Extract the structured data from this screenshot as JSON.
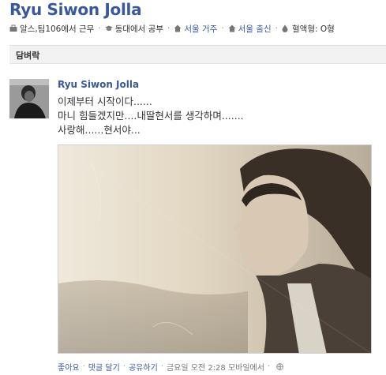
{
  "profile": {
    "name": "Ryu Siwon Jolla"
  },
  "info": {
    "work": "알스,팀106에서 근무",
    "school": "동대에서 공부",
    "lives": "서울 거주",
    "from": "서울 출신",
    "blood": "혈액형: O형"
  },
  "tab": {
    "label": "담벼락"
  },
  "post": {
    "author": "Ryu Siwon Jolla",
    "lines": [
      "이제부터 시작이다......",
      "마니 힘들겠지만....내딸현서를 생각하며.......",
      "사랑해......현서야..."
    ]
  },
  "actions": {
    "like": "좋아요",
    "comment": "댓글 달기",
    "share": "공유하기",
    "timestamp": "금요일 오전 2:28 모바일에서"
  },
  "icons": {
    "work": "briefcase-icon",
    "school": "graduation-cap-icon",
    "lives": "house-icon",
    "from": "house-icon",
    "blood": "blood-drop-icon",
    "privacy": "globe-icon"
  },
  "colors": {
    "brand": "#3b5998",
    "text": "#333333",
    "tab_bg": "#f2f2f2"
  }
}
